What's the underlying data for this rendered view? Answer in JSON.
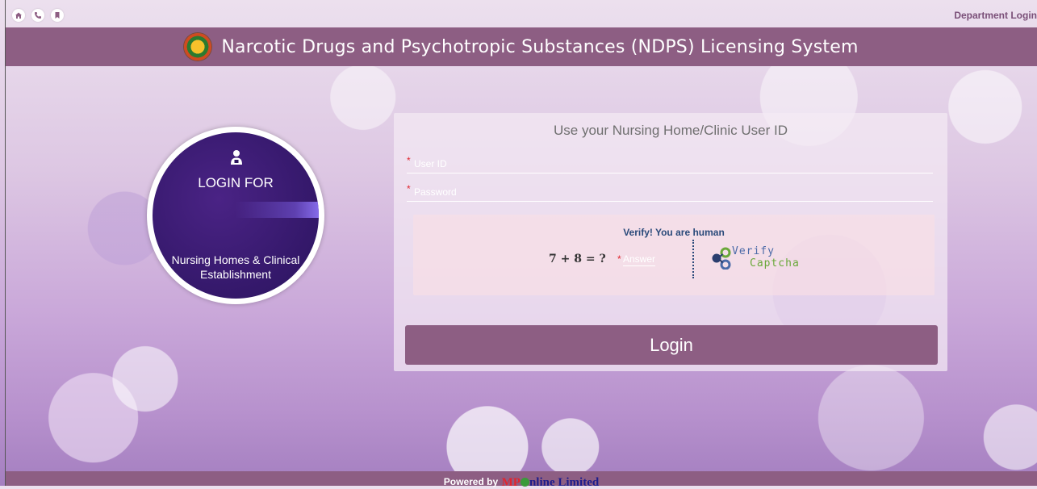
{
  "topbar": {
    "icons": [
      "home-icon",
      "phone-icon",
      "bookmark-icon"
    ],
    "department_login": "Department Login"
  },
  "header": {
    "title": "Narcotic Drugs and Psychotropic Substances (NDPS) Licensing System"
  },
  "login_badge": {
    "login_for": "LOGIN FOR",
    "category": "Nursing Homes & Clinical Establishment"
  },
  "form": {
    "title": "Use your Nursing Home/Clinic User ID",
    "user_id_label": "User ID",
    "password_label": "Password",
    "captcha": {
      "header": "Verify! You are human",
      "question": "7 + 8 = ?",
      "answer_label": "Answer",
      "verify_line1": "Verify",
      "verify_line2": "Captcha"
    },
    "login_button": "Login"
  },
  "footer": {
    "powered_by": "Powered by",
    "brand_mp": "MP",
    "brand_rest": "nline Limited"
  },
  "colors": {
    "accent": "#8d5e83",
    "badge_dark": "#2a135e"
  }
}
